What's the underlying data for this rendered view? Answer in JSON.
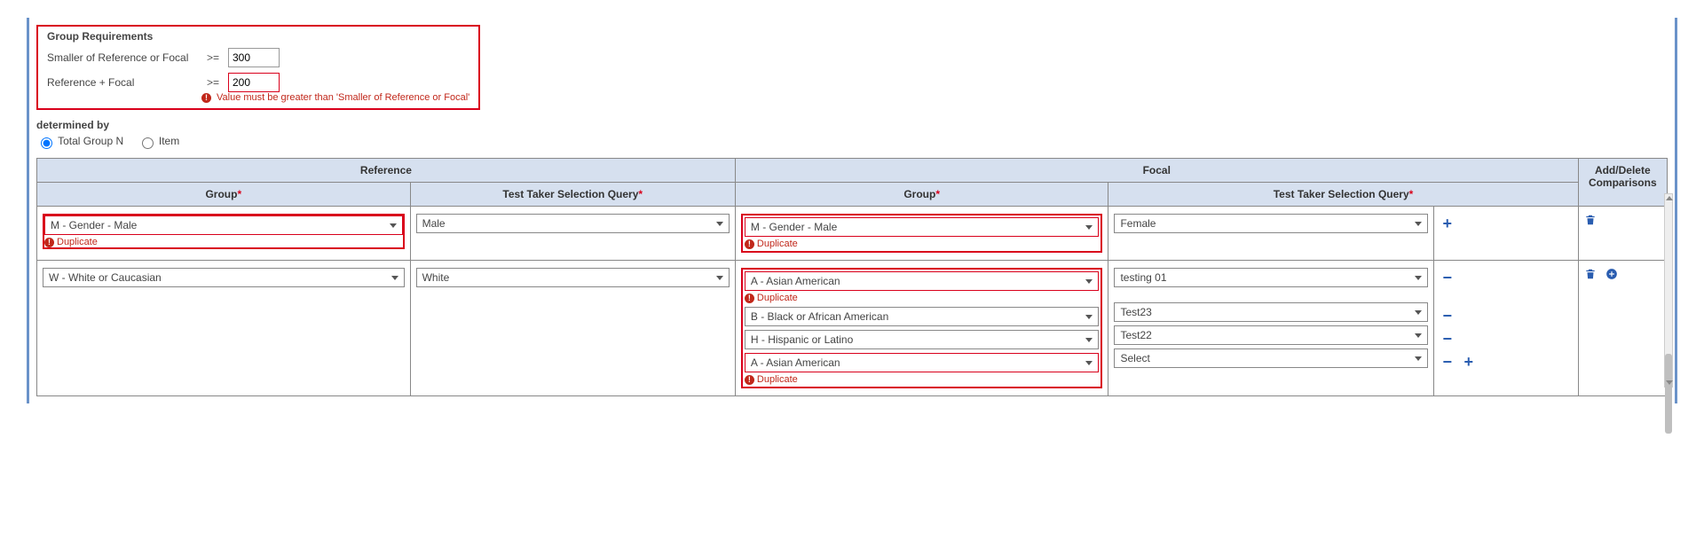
{
  "group_requirements": {
    "legend": "Group Requirements",
    "smaller_label": "Smaller of Reference or Focal",
    "sum_label": "Reference + Focal",
    "op": ">=",
    "smaller_value": "300",
    "sum_value": "200",
    "sum_error": "Value must be greater than 'Smaller of Reference or Focal'"
  },
  "determined_by": {
    "label": "determined by",
    "option_total": "Total Group N",
    "option_item": "Item",
    "selected": "total"
  },
  "headers": {
    "reference": "Reference",
    "focal": "Focal",
    "adddel": "Add/Delete Comparisons",
    "group": "Group",
    "query": "Test Taker Selection Query"
  },
  "errors": {
    "duplicate": "Duplicate"
  },
  "rows": [
    {
      "ref_group": "M - Gender - Male",
      "ref_group_err": true,
      "ref_query": "Male",
      "focal": [
        {
          "group": "M - Gender - Male",
          "group_err": true,
          "query": "Female",
          "pm": "plus"
        }
      ],
      "adddel": [
        "trash"
      ]
    },
    {
      "ref_group": "W - White or Caucasian",
      "ref_group_err": false,
      "ref_query": "White",
      "focal": [
        {
          "group": "A - Asian American",
          "group_err": true,
          "query": "testing 01",
          "pm": "minus"
        },
        {
          "group": "B - Black or African American",
          "group_err": false,
          "query": "Test23",
          "pm": "minus"
        },
        {
          "group": "H - Hispanic or Latino",
          "group_err": false,
          "query": "Test22",
          "pm": "minus"
        },
        {
          "group": "A - Asian American",
          "group_err": true,
          "query": "Select",
          "pm": "minusplus"
        }
      ],
      "adddel": [
        "trash",
        "pluscircle"
      ]
    }
  ]
}
